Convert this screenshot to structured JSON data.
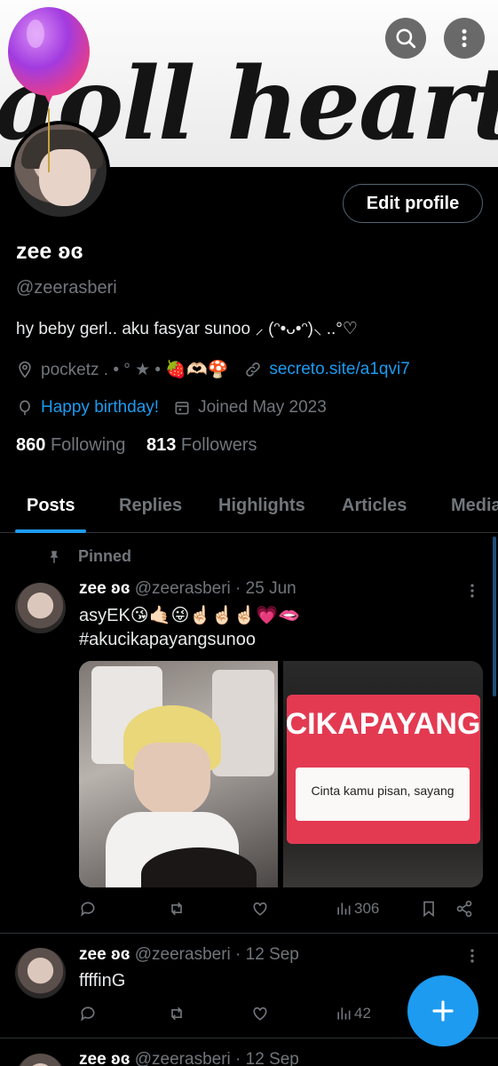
{
  "banner": {
    "text": "aoll hearted"
  },
  "header": {
    "search_icon": "search-icon",
    "more_icon": "more-vertical-icon"
  },
  "profile": {
    "edit_label": "Edit profile",
    "name": "zee ʚɞ",
    "handle": "@zeerasberi",
    "bio": "hy beby gerl.. aku fasyar sunoo ⸝ (ᵔ•ᴗ•ᵔ)⸜ ..°♡",
    "location": "pocketz . • ° ★ • 🍓🫶🏻🍄",
    "website": "secreto.site/a1qvi7",
    "birthday": "Happy birthday!",
    "joined": "Joined May 2023",
    "following_count": "860",
    "following_label": "Following",
    "followers_count": "813",
    "followers_label": "Followers"
  },
  "tabs": [
    "Posts",
    "Replies",
    "Highlights",
    "Articles",
    "Media"
  ],
  "posts": [
    {
      "pinned_label": "Pinned",
      "name": "zee ʚɞ",
      "handle": "@zeerasberi",
      "date": "· 25 Jun",
      "text": "asyEK😘🤙🏻😜☝🏻☝🏻☝🏻💗🫦",
      "hashtag": "#akucikapayangsunoo",
      "image_b_title": "CIKAPAYANG",
      "image_b_sub": "Cinta kamu pisan, sayang",
      "views": "306"
    },
    {
      "name": "zee ʚɞ",
      "handle": "@zeerasberi",
      "date": "· 12 Sep",
      "text": "ffffinG",
      "views": "42"
    },
    {
      "name": "zee ʚɞ",
      "handle": "@zeerasberi",
      "date": "· 12 Sep"
    }
  ],
  "fab_icon": "plus-icon",
  "colors": {
    "accent": "#1d9bf0",
    "background": "#000000",
    "muted": "#71767b"
  }
}
